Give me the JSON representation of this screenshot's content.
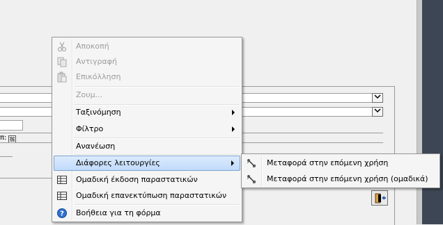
{
  "context_menu": {
    "items": [
      {
        "label": "Αποκοπή",
        "icon": "scissors-icon",
        "disabled": true
      },
      {
        "label": "Αντιγραφή",
        "icon": "copy-icon",
        "disabled": true
      },
      {
        "label": "Επικόλληση",
        "icon": "paste-icon",
        "disabled": true
      },
      {
        "label": "Ζουμ...",
        "disabled": true
      },
      {
        "label": "Ταξινόμηση",
        "has_submenu": true
      },
      {
        "label": "Φίλτρο",
        "has_submenu": true
      },
      {
        "label": "Ανανέωση"
      },
      {
        "label": "Διάφορες λειτουργίες",
        "has_submenu": true,
        "highlighted": true
      },
      {
        "label": "Ομαδική έκδοση παραστατικών",
        "icon": "grid-icon"
      },
      {
        "label": "Ομαδική επανεκτύπωση παραστατικών",
        "icon": "grid-icon"
      },
      {
        "label": "Βοήθεια για τη φόρμα",
        "icon": "help-icon"
      }
    ]
  },
  "submenu": {
    "items": [
      {
        "label": "Μεταφορά στην επόμενη χρήση",
        "icon": "transfer-icon"
      },
      {
        "label": "Μεταφορά στην επόμενη χρήση (ομαδικά)",
        "icon": "transfer-icon"
      }
    ]
  },
  "form": {
    "small_label": "π:"
  },
  "colors": {
    "highlight": "#c1dbfc",
    "disabled_text": "#9c9c9c",
    "right_dark": "#3d4654"
  }
}
